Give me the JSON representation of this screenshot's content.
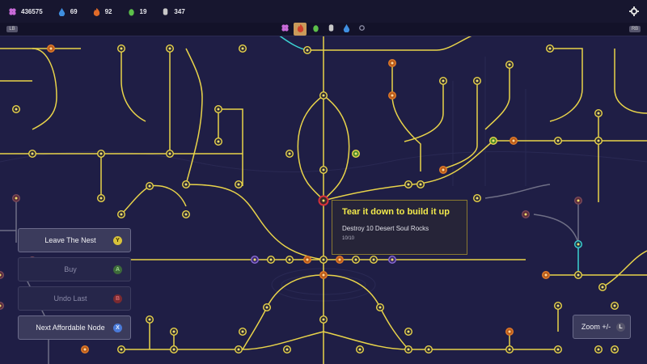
{
  "resources": [
    {
      "name": "purple-gem",
      "value": "436575",
      "color": "#c86ad8",
      "icon": "gem-cluster-icon"
    },
    {
      "name": "water",
      "value": "69",
      "color": "#3f8fe0",
      "icon": "water-drop-icon"
    },
    {
      "name": "fire",
      "value": "92",
      "color": "#e06a28",
      "icon": "flame-icon"
    },
    {
      "name": "seed",
      "value": "19",
      "color": "#5cc04a",
      "icon": "seed-icon"
    },
    {
      "name": "stone",
      "value": "347",
      "color": "#c8c8c8",
      "icon": "stone-icon"
    }
  ],
  "category_tabs": [
    {
      "icon": "gem-cluster-icon",
      "color": "#c86ad8",
      "selected": false
    },
    {
      "icon": "flame-icon",
      "color": "#e06a28",
      "selected": true
    },
    {
      "icon": "seed-icon",
      "color": "#5cc04a",
      "selected": false
    },
    {
      "icon": "stone-icon",
      "color": "#c8c8c8",
      "selected": false
    },
    {
      "icon": "water-drop-icon",
      "color": "#3f8fe0",
      "selected": false
    },
    {
      "icon": "sun-icon",
      "color": "#8888a0",
      "selected": false
    }
  ],
  "buttons": {
    "leave": {
      "label": "Leave The Nest",
      "key": "Y"
    },
    "buy": {
      "label": "Buy",
      "key": "A"
    },
    "undo": {
      "label": "Undo Last",
      "key": "B"
    },
    "next": {
      "label": "Next Affordable Node",
      "key": "X"
    },
    "zoom": {
      "label": "Zoom +/-",
      "key": "L"
    }
  },
  "tooltip": {
    "title": "Tear it down to build it up",
    "description": "Destroy 10 Desert Soul Rocks",
    "progress": "10/10"
  },
  "colors": {
    "line": "#e9d44a",
    "cyan_line": "#3cd2d2",
    "gray_line": "#6f6f86",
    "node_fill": "#2a2836",
    "node_ring": "#e9d44a",
    "orange": "#e07a2a",
    "purple": "#8a6ad8",
    "red": "#d8303a"
  }
}
